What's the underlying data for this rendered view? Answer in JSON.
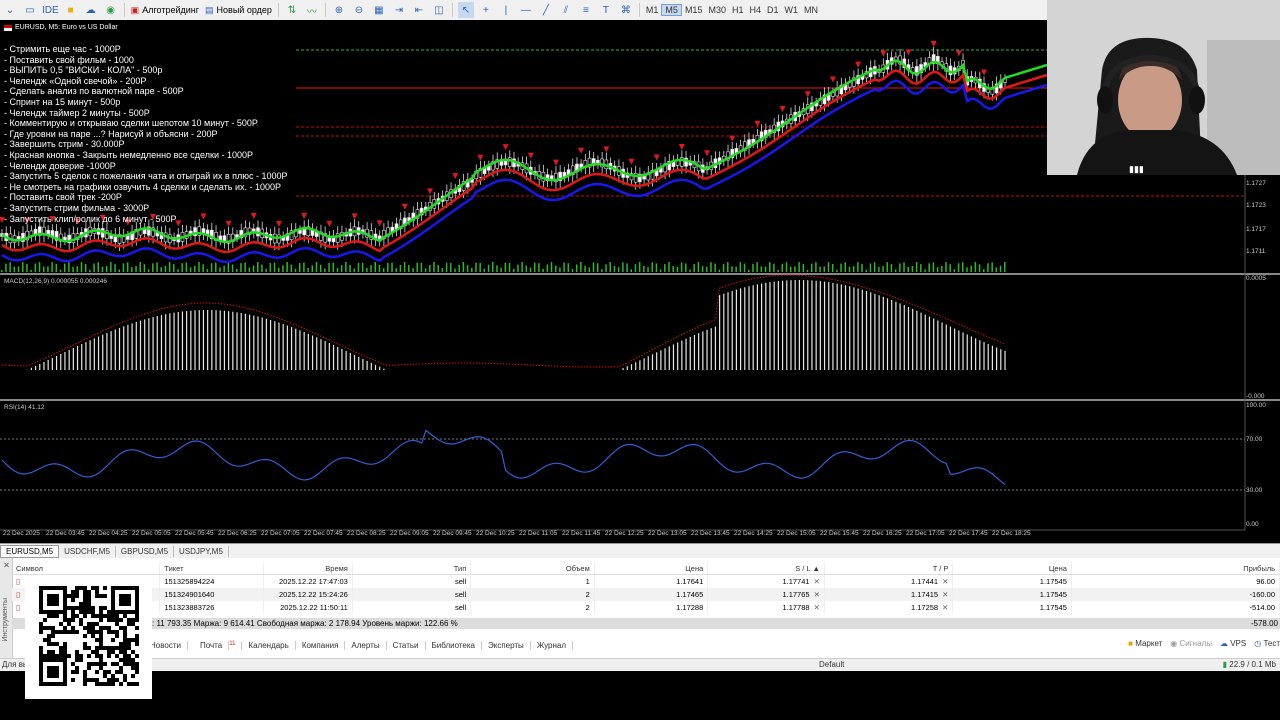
{
  "toolbar": {
    "algo_label": "Алготрейдинг",
    "new_order_label": "Новый ордер",
    "ide_label": "IDE",
    "timeframes": [
      "M1",
      "M5",
      "M15",
      "M30",
      "H1",
      "H4",
      "D1",
      "W1",
      "MN"
    ],
    "active_timeframe": "M5"
  },
  "chart": {
    "title": "EURUSD, M5:  Euro vs US Dollar",
    "macd_label": "MACD(12,26,9) 0.000055 0.000246",
    "rsi_label": "RSI(14) 41.12",
    "price_ticks": [
      "1.1727",
      "1.1723",
      "1.1717",
      "1.1711"
    ],
    "macd_ticks": [
      "0.0005",
      "-0.000"
    ],
    "rsi_ticks": [
      "100.00",
      "70.00",
      "30.00",
      "0.00"
    ],
    "time_labels": [
      "22 Dec 2025",
      "22 Dec 03:45",
      "22 Dec 04:25",
      "22 Dec 05:05",
      "22 Dec 05:45",
      "22 Dec 06:25",
      "22 Dec 07:05",
      "22 Dec 07:45",
      "22 Dec 08:25",
      "22 Dec 09:05",
      "22 Dec 09:45",
      "22 Dec 10:25",
      "22 Dec 11:05",
      "22 Dec 11:45",
      "22 Dec 12:25",
      "22 Dec 13:05",
      "22 Dec 13:45",
      "22 Dec 14:25",
      "22 Dec 15:05",
      "22 Dec 15:45",
      "22 Dec 16:25",
      "22 Dec 17:05",
      "22 Dec 17:45",
      "22 Dec 18:25"
    ]
  },
  "overlay_menu": [
    "- Стримить еще час - 1000Р",
    "- Поставить свой фильм - 1000",
    "- ВЫПИТЬ 0,5 \"ВИСКИ - КОЛА\" - 500р",
    "- Челендж «Одной свечой» - 200Р",
    "- Сделать анализ по валютной паре - 500Р",
    "- Спринт на 15 минут - 500р",
    "- Челендж таймер 2 минуты - 500Р",
    "- Комментирую и открываю сделки шепотом 10 минут - 500Р",
    "- Где уровни на паре ...? Нарисуй и объясни - 200Р",
    "- Завершить стрим - 30.000Р",
    "- Красная кнопка - Закрыть немедленно все сделки - 1000Р",
    "- Челендж доверие -1000Р",
    "- Запустить 5 сделок с пожелания чата и отыграй их в плюс - 1000Р",
    "- Не смотреть на графики озвучить 4 сделки и сделать их. - 1000Р",
    "- Поставить свой трек -200Р",
    "- Запустить стрим фильма - 3000Р",
    "- Запустить клип/ролик до 6 минут - 500Р"
  ],
  "symbol_tabs": [
    "EURUSD,M5",
    "USDCHF,M5",
    "GBPUSD,M5",
    "USDJPY,M5"
  ],
  "trade_table": {
    "headers": [
      "Символ",
      "Тикет",
      "Время",
      "Тип",
      "Объем",
      "Цена",
      "S / L",
      "T / P",
      "Цена",
      "Прибыль"
    ],
    "rows": [
      {
        "ticket": "151325894224",
        "time": "2025.12.22 17:47:03",
        "type": "sell",
        "volume": "1",
        "price": "1.17641",
        "sl": "1.17741",
        "tp": "1.17441",
        "current": "1.17545",
        "profit": "96.00"
      },
      {
        "ticket": "151324901640",
        "time": "2025.12.22 15:24:26",
        "type": "sell",
        "volume": "2",
        "price": "1.17465",
        "sl": "1.17765",
        "tp": "1.17415",
        "current": "1.17545",
        "profit": "-160.00"
      },
      {
        "ticket": "151323883726",
        "time": "2025.12.22 11:50:11",
        "type": "sell",
        "volume": "2",
        "price": "1.17288",
        "sl": "1.17788",
        "tp": "1.17258",
        "current": "1.17545",
        "profit": "-514.00"
      }
    ],
    "summary": ": 11 793.35  Маржа: 9 614.41  Свободная маржа: 2 178.94  Уровень маржи: 122.66 %",
    "total_profit": "-578.00"
  },
  "bottom_tabs": [
    "Новости",
    "Почта",
    "Календарь",
    "Компания",
    "Алерты",
    "Статьи",
    "Библиотека",
    "Эксперты",
    "Журнал"
  ],
  "mail_badge": "11",
  "side_label": "Инструменты",
  "right_tools": [
    "Маркет",
    "Сигналы",
    "VPS",
    "Тест"
  ],
  "status": {
    "left": "Для вы",
    "profile": "Default",
    "connection": "22.9 / 0.1 Mb"
  },
  "colors": {
    "bull_candle": "#ffffff",
    "ma_fast": "#22dd22",
    "ma_mid": "#e01818",
    "ma_slow": "#1818ee",
    "rsi_line": "#2f5fd8",
    "macd_signal": "#d01010"
  }
}
